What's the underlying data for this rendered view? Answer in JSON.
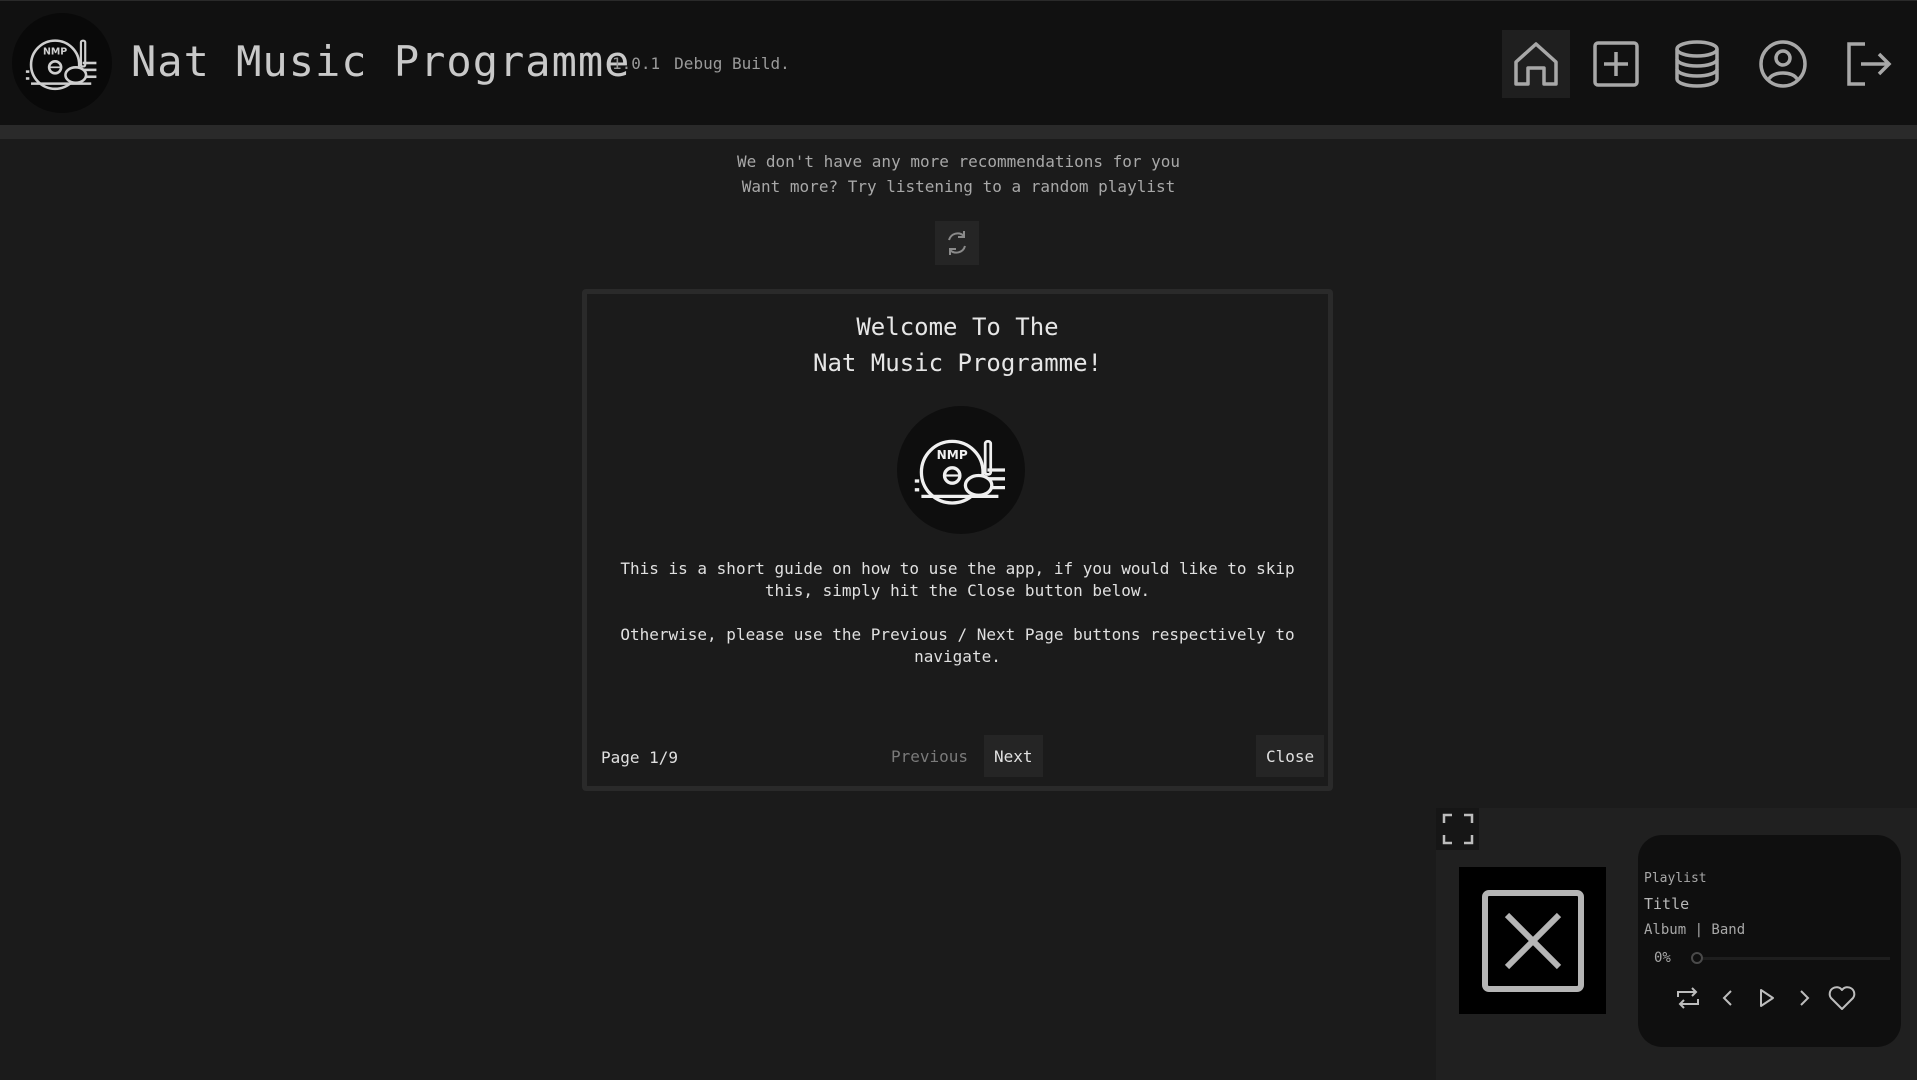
{
  "header": {
    "logo_text": "NMP",
    "title": "Nat Music Programme",
    "version": "1.0.1",
    "build": "Debug Build.",
    "nav": [
      {
        "name": "home",
        "icon": "home-icon",
        "active": true
      },
      {
        "name": "add",
        "icon": "plus-square-icon",
        "active": false
      },
      {
        "name": "database",
        "icon": "database-icon",
        "active": false
      },
      {
        "name": "profile",
        "icon": "user-circle-icon",
        "active": false
      },
      {
        "name": "logout",
        "icon": "logout-icon",
        "active": false
      }
    ]
  },
  "recommendations": {
    "line1": "We don't have any more recommendations for you",
    "line2": "Want more? Try listening to a random playlist",
    "refresh_icon": "refresh-icon"
  },
  "welcome": {
    "title_line1": "Welcome To The",
    "title_line2": "Nat Music Programme!",
    "logo_text": "NMP",
    "paragraph1": "This is a short guide on how to use the app, if you would like to skip this, simply hit the Close button below.",
    "paragraph2": "Otherwise, please use the Previous / Next Page buttons respectively to navigate.",
    "page_label": "Page 1/9",
    "previous_label": "Previous",
    "next_label": "Next",
    "close_label": "Close"
  },
  "player": {
    "expand_icon": "fullscreen-icon",
    "album_art_icon": "no-image-icon",
    "playlist": "Playlist",
    "title": "Title",
    "artist": "Album | Band",
    "progress_label": "0%",
    "progress": 0,
    "controls": [
      "repeat-icon",
      "previous-icon",
      "play-icon",
      "next-icon",
      "heart-icon"
    ]
  },
  "colors": {
    "background": "#1b1b1b",
    "header": "#111111",
    "panel_border": "#2a2a2a",
    "button": "#252525",
    "text": "#e0e0e0",
    "muted_text": "#7a7a7a"
  }
}
